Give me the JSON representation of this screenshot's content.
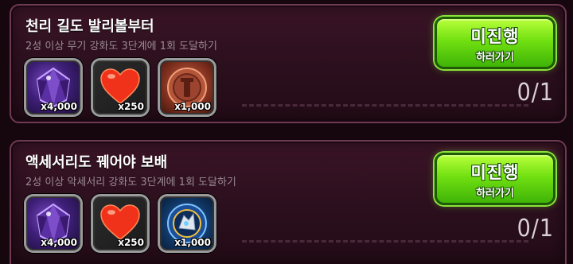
{
  "quests": [
    {
      "title": "천리 길도 발리볼부터",
      "description": "2성 이상 무기 강화도 3단계에 1회 도달하기",
      "rewards": [
        {
          "icon": "purple-gem-icon",
          "quantity": "x4,000"
        },
        {
          "icon": "heart-icon",
          "quantity": "x250"
        },
        {
          "icon": "bronze-coin-icon",
          "quantity": "x1,000"
        }
      ],
      "button_label": "미진행",
      "button_sub": "하러가기",
      "progress": "0/1"
    },
    {
      "title": "액세서리도 꿰어야 보배",
      "description": "2성 이상 악세서리 강화도 3단계에 1회 도달하기",
      "rewards": [
        {
          "icon": "purple-gem-icon",
          "quantity": "x4,000"
        },
        {
          "icon": "heart-icon",
          "quantity": "x250"
        },
        {
          "icon": "blue-emblem-icon",
          "quantity": "x1,000"
        }
      ],
      "button_label": "미진행",
      "button_sub": "하러가기",
      "progress": "0/1"
    }
  ],
  "colors": {
    "button_green": "#71e011",
    "panel_bg": "#2b0f1d",
    "panel_border": "#6e3a53"
  }
}
